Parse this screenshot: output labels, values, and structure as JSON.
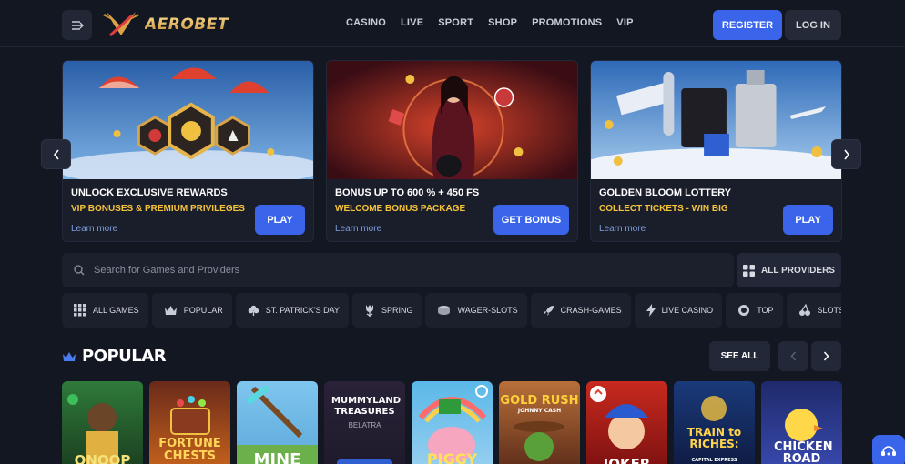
{
  "header": {
    "logo_text": "AEROBET",
    "nav": [
      "CASINO",
      "LIVE",
      "SPORT",
      "SHOP",
      "PROMOTIONS",
      "VIP"
    ],
    "register_label": "REGISTER",
    "login_label": "LOG IN"
  },
  "promos": [
    {
      "title": "UNLOCK EXCLUSIVE REWARDS",
      "subtitle": "VIP BONUSES & PREMIUM PRIVILEGES",
      "link": "Learn more",
      "button": "PLAY"
    },
    {
      "title": "BONUS UP TO 600 % + 450 FS",
      "subtitle": "WELCOME BONUS PACKAGE",
      "link": "Learn more",
      "button": "GET BONUS"
    },
    {
      "title": "GOLDEN BLOOM LOTTERY",
      "subtitle": "COLLECT TICKETS - WIN BIG",
      "link": "Learn more",
      "button": "PLAY"
    }
  ],
  "search": {
    "placeholder": "Search for Games and Providers"
  },
  "providers_label": "ALL PROVIDERS",
  "categories": [
    "ALL GAMES",
    "POPULAR",
    "ST. PATRICK'S DAY",
    "SPRING",
    "WAGER-SLOTS",
    "CRASH-GAMES",
    "LIVE CASINO",
    "TOP",
    "SLOTS"
  ],
  "popular": {
    "title": "POPULAR",
    "see_all": "SEE ALL",
    "games": [
      {
        "name": "QNOOP",
        "sub": ""
      },
      {
        "name": "FORTUNE CHESTS",
        "sub": ""
      },
      {
        "name": "MINE",
        "sub": ""
      },
      {
        "name": "MUMMYLAND TREASURES",
        "sub": "BELATRA"
      },
      {
        "name": "PIGGY",
        "sub": ""
      },
      {
        "name": "GOLD RUSH",
        "sub": "JOHNNY CASH"
      },
      {
        "name": "JOKER",
        "sub": ""
      },
      {
        "name": "TRAIN to RICHES:",
        "sub": "CAPITAL EXPRESS"
      },
      {
        "name": "CHICKEN ROAD",
        "sub": ""
      }
    ]
  },
  "colors": {
    "accent": "#3a64ea",
    "gold": "#f5c33b",
    "background": "#131722"
  }
}
